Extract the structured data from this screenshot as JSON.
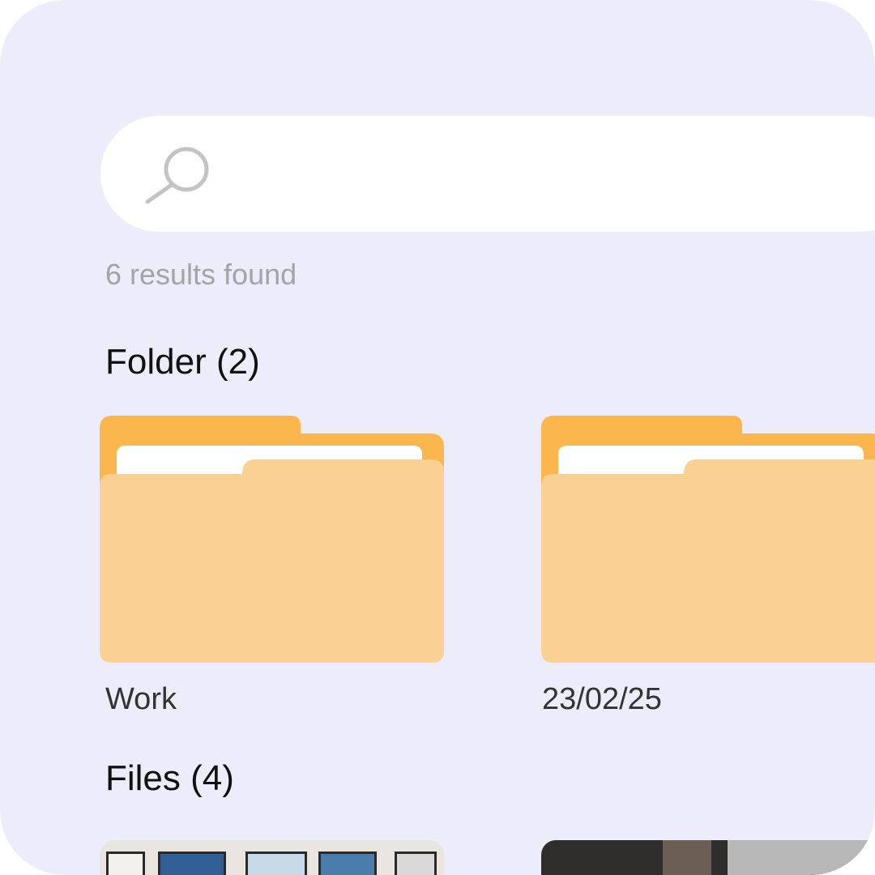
{
  "search": {
    "icon": "search-icon",
    "value": ""
  },
  "results": {
    "count_text": "6 results found"
  },
  "sections": {
    "folders": {
      "title": "Folder (2)",
      "items": [
        {
          "name": "Work",
          "icon": "folder-icon"
        },
        {
          "name": "23/02/25",
          "icon": "folder-icon"
        }
      ]
    },
    "files": {
      "title": "Files (4)"
    }
  },
  "colors": {
    "background": "#edecfa",
    "surface": "#ffffff",
    "folder_back": "#fbb64d",
    "folder_front": "#fbd193",
    "muted_text": "#a3a3a8"
  }
}
